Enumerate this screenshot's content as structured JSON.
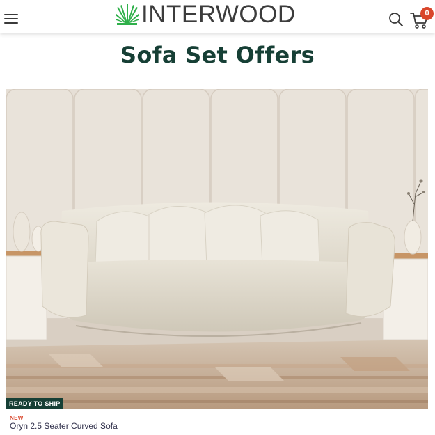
{
  "header": {
    "brand_name": "INTERWOOD",
    "cart_count": "0",
    "icons": {
      "menu": "hamburger-menu-icon",
      "logo": "palm-leaf-logo-icon",
      "search": "search-icon",
      "cart": "shopping-cart-icon"
    },
    "colors": {
      "brand_green": "#2fb04a",
      "badge": "#d9462b"
    }
  },
  "page": {
    "title": "Sofa Set Offers",
    "title_color": "#163f35"
  },
  "product": {
    "availability_badge": "READY TO SHIP",
    "new_label": "NEW",
    "name": "Oryn 2.5 Seater Curved Sofa"
  }
}
